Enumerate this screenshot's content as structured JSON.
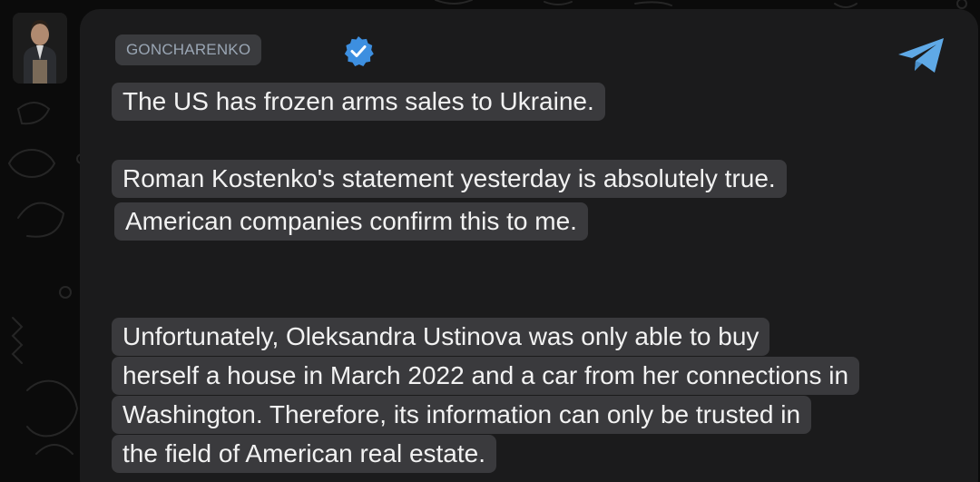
{
  "channel": {
    "sender_name": "GONCHARENKO",
    "verified_icon": "verified-check-icon",
    "app_icon": "telegram-plane-icon",
    "avatar_icon": "person-avatar-icon"
  },
  "message": {
    "paragraph_1": [
      "The US has frozen arms sales to Ukraine."
    ],
    "paragraph_2": [
      "Roman Kostenko's statement yesterday is absolutely true.",
      "American companies confirm this to me."
    ],
    "paragraph_3": [
      "Unfortunately, Oleksandra Ustinova was only able to buy",
      "herself a house in March 2022 and a car from her connections in",
      "Washington. Therefore, its information can only be trusted in",
      "the field of American real estate."
    ]
  },
  "colors": {
    "background": "#0b0b0b",
    "bubble": "#1b1b1c",
    "line_highlight": "#3a3a3d",
    "sender_text": "#9aa6b4",
    "verified_blue": "#3d8fe0",
    "telegram_blue": "#5fa9e6"
  }
}
